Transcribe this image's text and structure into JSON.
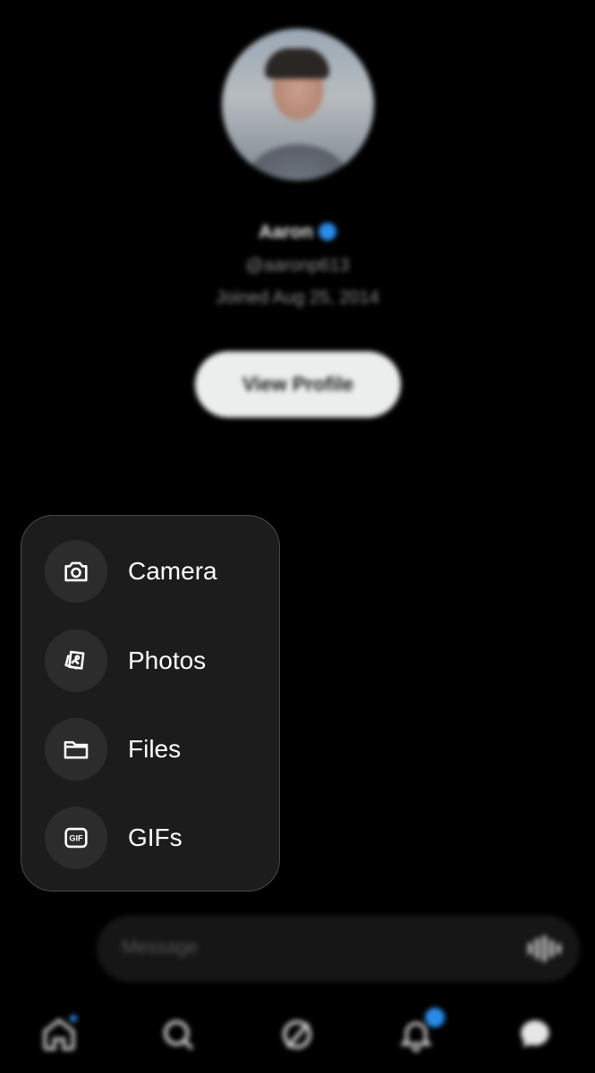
{
  "profile": {
    "name": "Aaron",
    "handle": "@aaronp613",
    "joined": "Joined Aug 25, 2014",
    "view_profile_label": "View Profile"
  },
  "attach_menu": {
    "items": [
      {
        "label": "Camera",
        "icon": "camera-icon"
      },
      {
        "label": "Photos",
        "icon": "photos-icon"
      },
      {
        "label": "Files",
        "icon": "folder-icon"
      },
      {
        "label": "GIFs",
        "icon": "gif-icon"
      }
    ]
  },
  "composer": {
    "placeholder": "Message",
    "voice_icon": "voice-icon"
  },
  "tabbar": {
    "tabs": [
      {
        "icon": "home-icon",
        "has_dot": true
      },
      {
        "icon": "search-icon"
      },
      {
        "icon": "grok-icon"
      },
      {
        "icon": "notifications-icon",
        "has_badge": true
      },
      {
        "icon": "messages-icon"
      }
    ]
  },
  "colors": {
    "accent": "#2a8ce8",
    "menu_bg": "#1c1c1c",
    "icon_circle": "#2c2c2c"
  }
}
